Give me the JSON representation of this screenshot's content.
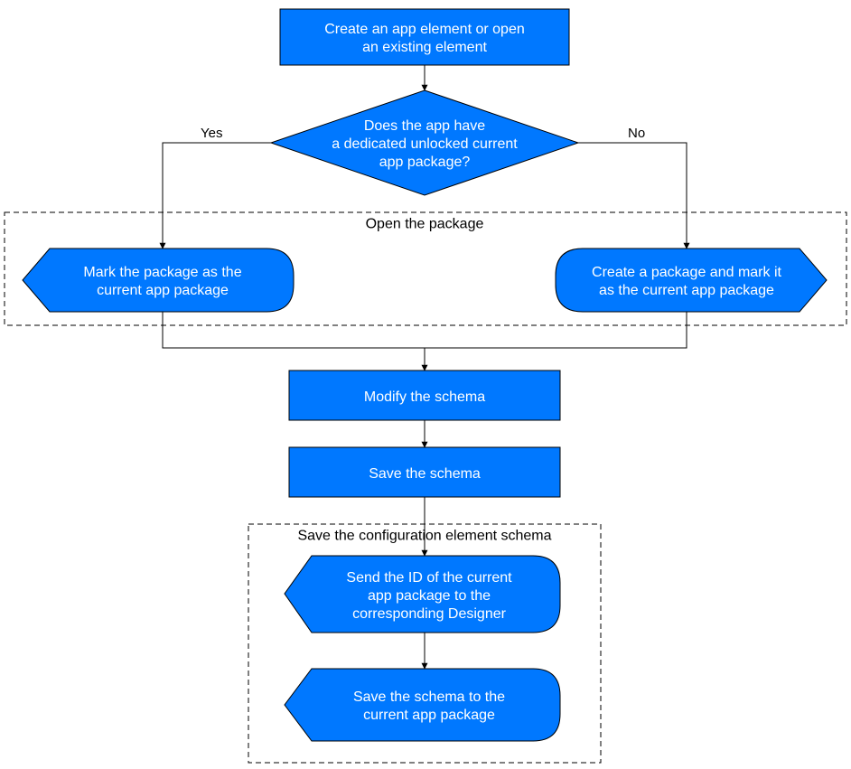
{
  "chart_data": {
    "type": "flowchart",
    "nodes": [
      {
        "id": "start",
        "type": "process",
        "text": [
          "Create an app element or open",
          "an existing element"
        ]
      },
      {
        "id": "decide",
        "type": "decision",
        "text": [
          "Does the app have",
          "a dedicated unlocked current",
          "app package?"
        ]
      },
      {
        "id": "markpkg",
        "type": "tag-left",
        "text": [
          "Mark the package as the",
          "current app package"
        ]
      },
      {
        "id": "newpkg",
        "type": "tag-right",
        "text": [
          "Create a package and mark it",
          "as the current app package"
        ]
      },
      {
        "id": "modify",
        "type": "process",
        "text": [
          "Modify the schema"
        ]
      },
      {
        "id": "save",
        "type": "process",
        "text": [
          "Save the schema"
        ]
      },
      {
        "id": "sendid",
        "type": "tag-left",
        "text": [
          "Send the ID of the current",
          "app package to the",
          "corresponding Designer"
        ]
      },
      {
        "id": "saveto",
        "type": "tag-left",
        "text": [
          "Save the schema to the",
          "current app package"
        ]
      }
    ],
    "edges": [
      {
        "from": "start",
        "to": "decide"
      },
      {
        "from": "decide",
        "to": "markpkg",
        "label": "Yes"
      },
      {
        "from": "decide",
        "to": "newpkg",
        "label": "No"
      },
      {
        "from": "markpkg",
        "to": "modify"
      },
      {
        "from": "newpkg",
        "to": "modify"
      },
      {
        "from": "modify",
        "to": "save"
      },
      {
        "from": "save",
        "to": "sendid"
      },
      {
        "from": "sendid",
        "to": "saveto"
      }
    ],
    "groups": [
      {
        "label": "Open the package",
        "contains": [
          "markpkg",
          "newpkg"
        ]
      },
      {
        "label": "Save the configuration element schema",
        "contains": [
          "sendid",
          "saveto"
        ]
      }
    ]
  },
  "labels": {
    "yes": "Yes",
    "no": "No",
    "open_group": "Open the package",
    "save_group": "Save the configuration element schema"
  },
  "colors": {
    "fill": "#0078ff",
    "stroke": "#000",
    "dash": "#000"
  }
}
